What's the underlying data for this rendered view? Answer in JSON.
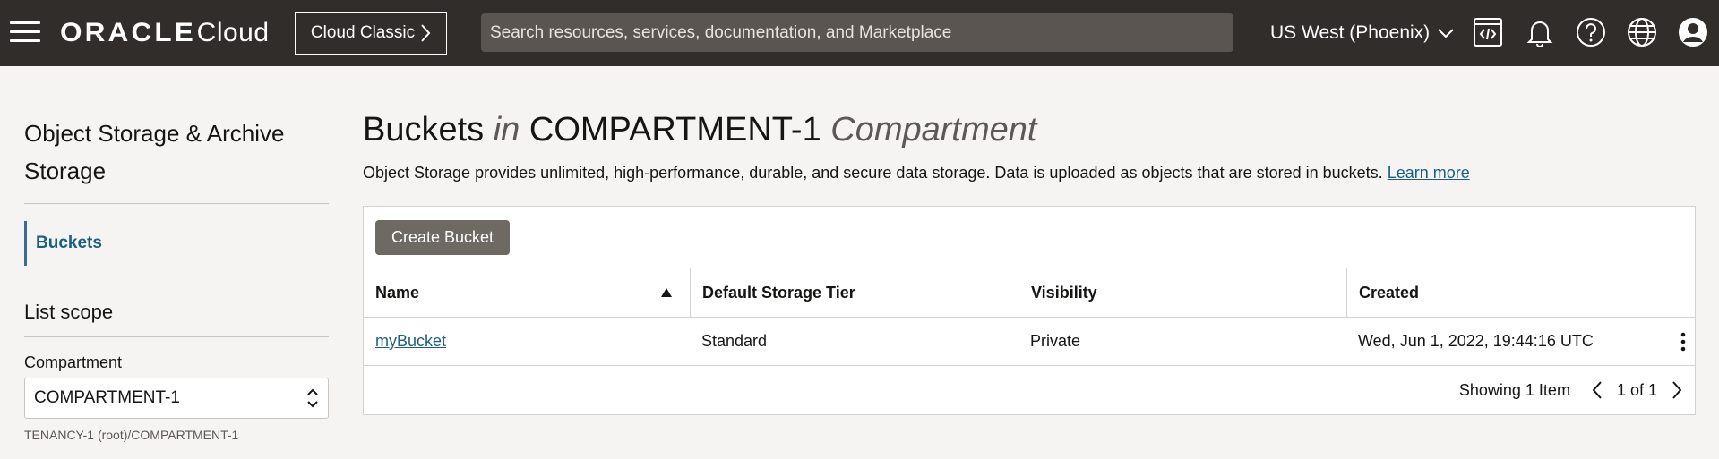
{
  "header": {
    "brand_oracle": "ORACLE",
    "brand_cloud": "Cloud",
    "classic_label": "Cloud Classic",
    "search_placeholder": "Search resources, services, documentation, and Marketplace",
    "region": "US West (Phoenix)"
  },
  "sidebar": {
    "title": "Object Storage & Archive Storage",
    "items": [
      {
        "label": "Buckets",
        "active": true
      }
    ],
    "scope_title": "List scope",
    "compartment_label": "Compartment",
    "compartment_value": "COMPARTMENT-1",
    "compartment_path": "TENANCY-1 (root)/COMPARTMENT-1"
  },
  "main": {
    "heading_buckets": "Buckets",
    "heading_in": "in",
    "heading_compartment_name": "COMPARTMENT-1",
    "heading_compartment_word": "Compartment",
    "description": "Object Storage provides unlimited, high-performance, durable, and secure data storage. Data is uploaded as objects that are stored in buckets.",
    "learn_more": "Learn more",
    "create_button": "Create Bucket",
    "table": {
      "columns": [
        "Name",
        "Default Storage Tier",
        "Visibility",
        "Created"
      ],
      "rows": [
        {
          "name": "myBucket",
          "tier": "Standard",
          "visibility": "Private",
          "created": "Wed, Jun 1, 2022, 19:44:16 UTC"
        }
      ]
    },
    "pagination": {
      "showing": "Showing 1 Item",
      "page": "1 of 1"
    }
  },
  "colors": {
    "topbar": "#312d2a",
    "link": "#1a5f80",
    "button": "#6f6964"
  },
  "icons": [
    "hamburger-icon",
    "chevron-right-icon",
    "chevron-down-icon",
    "code-editor-icon",
    "bell-icon",
    "help-icon",
    "globe-icon",
    "profile-icon",
    "sort-asc-icon",
    "kebab-icon",
    "chevron-left-icon"
  ]
}
